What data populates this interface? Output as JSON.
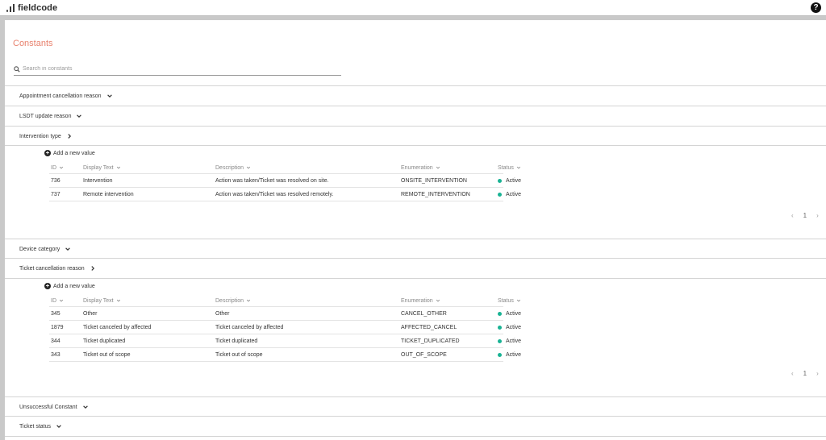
{
  "app": {
    "logo_text": "fieldcode",
    "help_label": "?"
  },
  "page": {
    "title": "Constants"
  },
  "search": {
    "placeholder": "Search in constants"
  },
  "columns": {
    "id": "ID",
    "display": "Display Text",
    "description": "Description",
    "enumeration": "Enumeration",
    "status": "Status"
  },
  "add_label": "Add a new value",
  "sections": [
    {
      "label": "Appointment cancellation reason",
      "expanded": false
    },
    {
      "label": "LSDT update reason",
      "expanded": false
    },
    {
      "label": "Intervention type",
      "expanded": true,
      "rows": [
        {
          "id": "736",
          "display": "Intervention",
          "description": "Action was taken/Ticket was resolved on site.",
          "enumeration": "ONSITE_INTERVENTION",
          "status": "Active"
        },
        {
          "id": "737",
          "display": "Remote intervention",
          "description": "Action was taken/Ticket was resolved remotely.",
          "enumeration": "REMOTE_INTERVENTION",
          "status": "Active"
        }
      ],
      "page": "1"
    },
    {
      "label": "Device category",
      "expanded": false
    },
    {
      "label": "Ticket cancellation reason",
      "expanded": true,
      "rows": [
        {
          "id": "345",
          "display": "Other",
          "description": "Other",
          "enumeration": "CANCEL_OTHER",
          "status": "Active"
        },
        {
          "id": "1879",
          "display": "Ticket canceled by affected",
          "description": "Ticket canceled by affected",
          "enumeration": "AFFECTED_CANCEL",
          "status": "Active"
        },
        {
          "id": "344",
          "display": "Ticket duplicated",
          "description": "Ticket duplicated",
          "enumeration": "TICKET_DUPLICATED",
          "status": "Active"
        },
        {
          "id": "343",
          "display": "Ticket out of scope",
          "description": "Ticket out of scope",
          "enumeration": "OUT_OF_SCOPE",
          "status": "Active"
        }
      ],
      "page": "1"
    },
    {
      "label": "Unsuccessful Constant",
      "expanded": false
    },
    {
      "label": "Ticket status",
      "expanded": false
    }
  ],
  "colors": {
    "accent": "#e8826e",
    "active": "#19b394"
  },
  "icons": {
    "logo": "fieldcode-bars-icon",
    "help": "question-circle-icon",
    "search": "search-icon",
    "expand": "chevron-down-icon",
    "collapse": "chevron-right-icon",
    "add": "plus-circle-icon",
    "sort": "caret-down-icon",
    "prev": "chevron-left-icon",
    "next": "chevron-right-icon"
  }
}
